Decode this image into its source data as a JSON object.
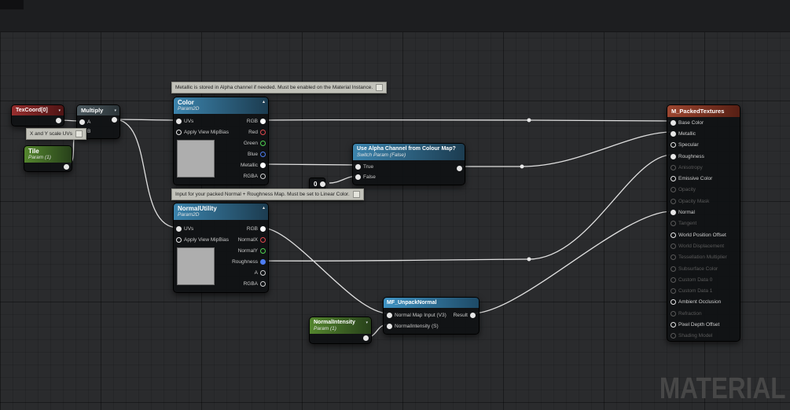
{
  "canvas": {
    "watermark": "MATERIAL"
  },
  "icons": {
    "dropdown": "▾",
    "collapse": "▴"
  },
  "colors": {
    "wire": "#e0e0e0",
    "header_texture": "#3c84ad",
    "header_param_green": "#54862e",
    "header_material": "#9c4630",
    "header_function": "#3f93c4",
    "header_texcoord": "#962e2e",
    "header_operator": "#4b585e",
    "pin_red": "#e0484d",
    "pin_green": "#4fd14f",
    "pin_blue": "#4d7df2",
    "pin_white": "#ffffff",
    "pin_gray": "#cfcfcf"
  },
  "tooltips": {
    "metallic": "Metallic is stored in Alpha channel if needed. Must be enabled on the Material Instance.",
    "uv_scale": "X and Y scale UVs",
    "linear": "Input for your packed Normal + Roughness Map. Must be set to Linear Color."
  },
  "nodes": {
    "texcoord": {
      "title": "TexCoord[0]"
    },
    "multiply": {
      "title": "Multiply",
      "inputs": [
        {
          "label": "A",
          "filled": true
        },
        {
          "label": "B",
          "filled": true
        }
      ]
    },
    "tile": {
      "title": "Tile",
      "subtitle": "Param (1)"
    },
    "color": {
      "title": "Color",
      "subtitle": "Param2D",
      "inputs": [
        {
          "label": "UVs",
          "filled": true
        },
        {
          "label": "Apply View MipBias",
          "filled": false
        }
      ],
      "outputs": [
        {
          "label": "RGB",
          "color": "#ffffff",
          "filled": true
        },
        {
          "label": "Red",
          "color": "#e0484d",
          "filled": false
        },
        {
          "label": "Green",
          "color": "#4fd14f",
          "filled": false
        },
        {
          "label": "Blue",
          "color": "#4d7df2",
          "filled": false
        },
        {
          "label": "Metallic",
          "color": "#ffffff",
          "filled": true
        },
        {
          "label": "RGBA",
          "color": "#cfcfcf",
          "filled": false
        }
      ]
    },
    "alpha_switch": {
      "title": "Use Alpha Channel from Colour Map?",
      "subtitle": "Switch Param (False)",
      "inputs": [
        {
          "label": "True",
          "filled": true
        },
        {
          "label": "False",
          "filled": true
        }
      ]
    },
    "const_zero": {
      "value": "0"
    },
    "normal_utility": {
      "title": "NormalUtility",
      "subtitle": "Param2D",
      "inputs": [
        {
          "label": "UVs",
          "filled": true
        },
        {
          "label": "Apply View MipBias",
          "filled": false
        }
      ],
      "outputs": [
        {
          "label": "RGB",
          "color": "#ffffff",
          "filled": true
        },
        {
          "label": "NormalX",
          "color": "#e0484d",
          "filled": false
        },
        {
          "label": "NormalY",
          "color": "#4fd14f",
          "filled": false
        },
        {
          "label": "Roughness",
          "color": "#4d7df2",
          "filled": true
        },
        {
          "label": "A",
          "color": "#cfcfcf",
          "filled": false
        },
        {
          "label": "RGBA",
          "color": "#cfcfcf",
          "filled": false
        }
      ]
    },
    "unpack_normal": {
      "title": "MF_UnpackNormal",
      "inputs": [
        {
          "label": "Normal Map Input (V3)",
          "filled": true
        },
        {
          "label": "NormalIntensity (S)",
          "filled": true
        }
      ],
      "outputs": [
        {
          "label": "Result",
          "filled": true
        }
      ]
    },
    "normal_intensity": {
      "title": "NormalIntensity",
      "subtitle": "Param (1)"
    },
    "material": {
      "title": "M_PackedTextures",
      "pins": [
        {
          "label": "Base Color",
          "state": "linked"
        },
        {
          "label": "Metallic",
          "state": "linked"
        },
        {
          "label": "Specular",
          "state": "open"
        },
        {
          "label": "Roughness",
          "state": "linked"
        },
        {
          "label": "Anisotropy",
          "state": "disabled"
        },
        {
          "label": "Emissive Color",
          "state": "open"
        },
        {
          "label": "Opacity",
          "state": "disabled"
        },
        {
          "label": "Opacity Mask",
          "state": "disabled"
        },
        {
          "label": "Normal",
          "state": "linked"
        },
        {
          "label": "Tangent",
          "state": "disabled"
        },
        {
          "label": "World Position Offset",
          "state": "open"
        },
        {
          "label": "World Displacement",
          "state": "disabled"
        },
        {
          "label": "Tessellation Multiplier",
          "state": "disabled"
        },
        {
          "label": "Subsurface Color",
          "state": "disabled"
        },
        {
          "label": "Custom Data 0",
          "state": "disabled"
        },
        {
          "label": "Custom Data 1",
          "state": "disabled"
        },
        {
          "label": "Ambient Occlusion",
          "state": "open"
        },
        {
          "label": "Refraction",
          "state": "disabled"
        },
        {
          "label": "Pixel Depth Offset",
          "state": "open"
        },
        {
          "label": "Shading Model",
          "state": "disabled"
        }
      ]
    }
  }
}
